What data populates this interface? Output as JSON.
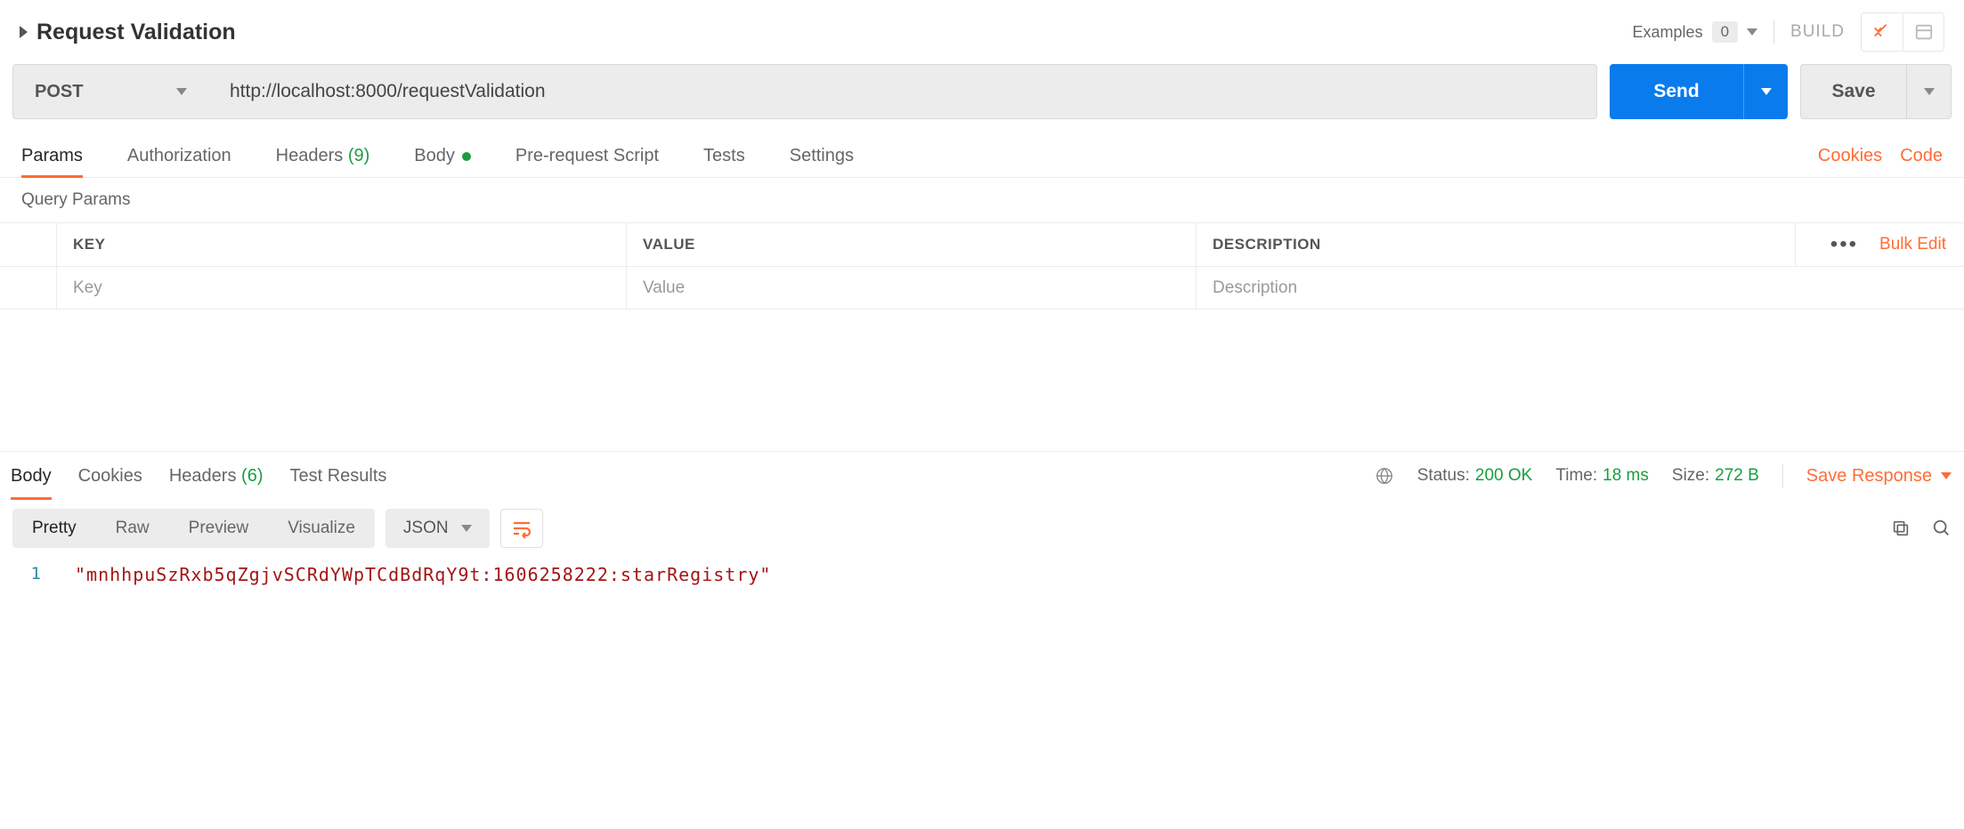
{
  "header": {
    "title": "Request Validation",
    "examples_label": "Examples",
    "examples_count": "0",
    "build_label": "BUILD"
  },
  "request": {
    "method": "POST",
    "url": "http://localhost:8000/requestValidation",
    "send_label": "Send",
    "save_label": "Save"
  },
  "req_tabs": {
    "params": "Params",
    "authorization": "Authorization",
    "headers": "Headers",
    "headers_count": "(9)",
    "body": "Body",
    "prerequest": "Pre-request Script",
    "tests": "Tests",
    "settings": "Settings",
    "cookies": "Cookies",
    "code": "Code"
  },
  "query_params": {
    "section_title": "Query Params",
    "col_key": "KEY",
    "col_value": "VALUE",
    "col_description": "DESCRIPTION",
    "bulk_edit": "Bulk Edit",
    "placeholder_key": "Key",
    "placeholder_value": "Value",
    "placeholder_description": "Description"
  },
  "resp_tabs": {
    "body": "Body",
    "cookies": "Cookies",
    "headers": "Headers",
    "headers_count": "(6)",
    "test_results": "Test Results"
  },
  "resp_meta": {
    "status_label": "Status:",
    "status_value": "200 OK",
    "time_label": "Time:",
    "time_value": "18 ms",
    "size_label": "Size:",
    "size_value": "272 B",
    "save_response": "Save Response"
  },
  "resp_view": {
    "pretty": "Pretty",
    "raw": "Raw",
    "preview": "Preview",
    "visualize": "Visualize",
    "format": "JSON"
  },
  "response_body": {
    "line_no": "1",
    "content": "\"mnhhpuSzRxb5qZgjvSCRdYWpTCdBdRqY9t:1606258222:starRegistry\""
  }
}
